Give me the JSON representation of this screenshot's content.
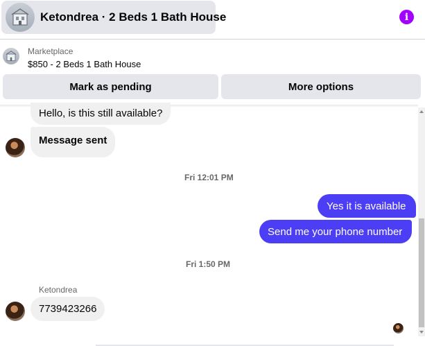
{
  "header": {
    "title": "Ketondrea · 2 Beds 1 Bath House",
    "info_icon": "info-icon",
    "accent_color": "#a200ff"
  },
  "listing": {
    "source_label": "Marketplace",
    "price_title": "$850 - 2 Beds 1 Bath House"
  },
  "actions": {
    "mark_pending_label": "Mark as pending",
    "more_options_label": "More options"
  },
  "conversation": {
    "messages": [
      {
        "direction": "incoming",
        "text": "Hello, is this still available?"
      },
      {
        "direction": "incoming",
        "text": "Message sent"
      },
      {
        "type": "timestamp",
        "text": "Fri 12:01 PM"
      },
      {
        "direction": "outgoing",
        "text": "Yes it is available"
      },
      {
        "direction": "outgoing",
        "text": "Send me your phone number"
      },
      {
        "type": "timestamp",
        "text": "Fri 1:50 PM"
      },
      {
        "direction": "incoming",
        "sender": "Ketondrea",
        "text": "7739423266"
      }
    ],
    "outgoing_color": "#4b3ef5",
    "incoming_color": "#f0f0f0"
  }
}
